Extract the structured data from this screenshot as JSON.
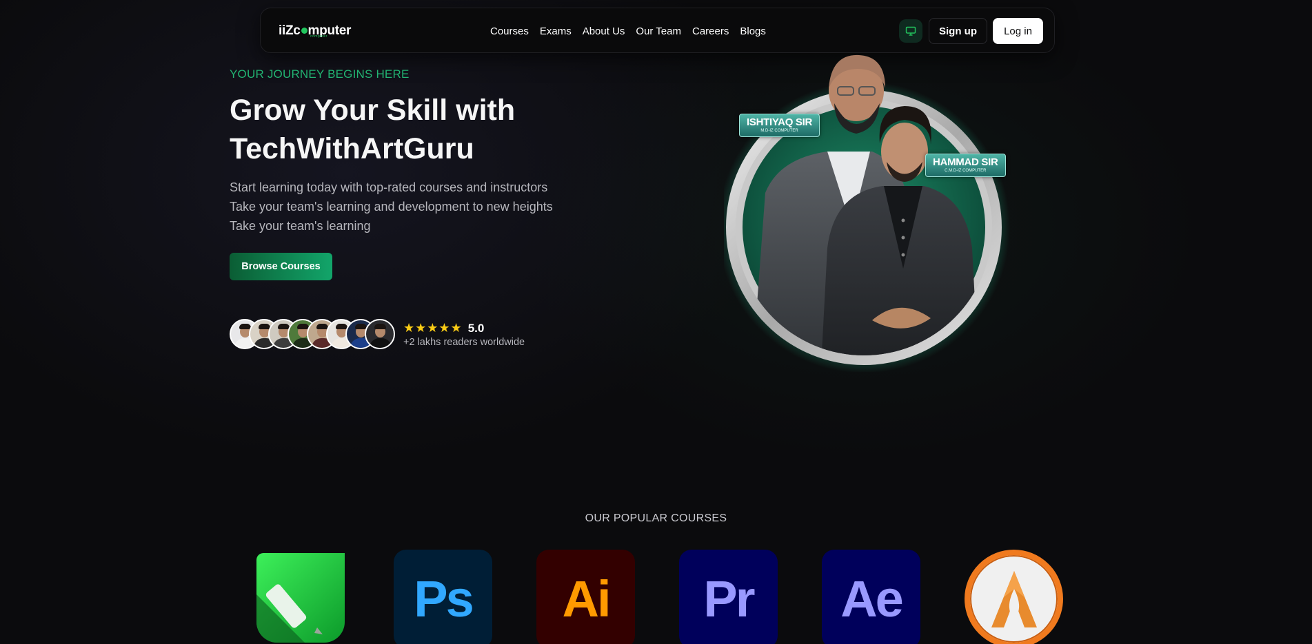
{
  "nav": {
    "logo_prefix": "iiZ",
    "logo_rest": "mputer",
    "logo_sub": "computer",
    "links": [
      "Courses",
      "Exams",
      "About Us",
      "Our Team",
      "Careers",
      "Blogs"
    ],
    "monitor_icon": "monitor-icon",
    "signup_label": "Sign up",
    "login_label": "Log in"
  },
  "hero": {
    "eyebrow": "YOUR JOURNEY BEGINS HERE",
    "title": "Grow Your Skill with TechWithArtGuru",
    "description": "Start learning today with top-rated courses and instructors Take your team's learning and development to new heights Take your team's learning",
    "browse_label": "Browse Courses",
    "rating": "5.0",
    "stars": "★★★★★",
    "readers": "+2 lakhs readers worldwide",
    "avatar_count": 8
  },
  "instructors": [
    {
      "name": "ISHTIYAQ SIR",
      "subtitle": "M.D-IZ COMPUTER"
    },
    {
      "name": "HAMMAD SIR",
      "subtitle": "C.M.D-IZ COMPUTER"
    }
  ],
  "popular": {
    "heading": "OUR POPULAR COURSES",
    "courses": [
      {
        "name": "pencil-app-icon",
        "text": ""
      },
      {
        "name": "photoshop-icon",
        "text": "Ps",
        "bg": "#001e36",
        "fg": "#31a8ff"
      },
      {
        "name": "illustrator-icon",
        "text": "Ai",
        "bg": "#330000",
        "fg": "#ff9a00"
      },
      {
        "name": "premiere-icon",
        "text": "Pr",
        "bg": "#00005b",
        "fg": "#9999ff"
      },
      {
        "name": "after-effects-icon",
        "text": "Ae",
        "bg": "#00005b",
        "fg": "#9999ff"
      },
      {
        "name": "autocad-icon",
        "text": ""
      }
    ]
  },
  "colors": {
    "accent": "#22b573",
    "star": "#facc15",
    "background": "#0b0b0d"
  }
}
